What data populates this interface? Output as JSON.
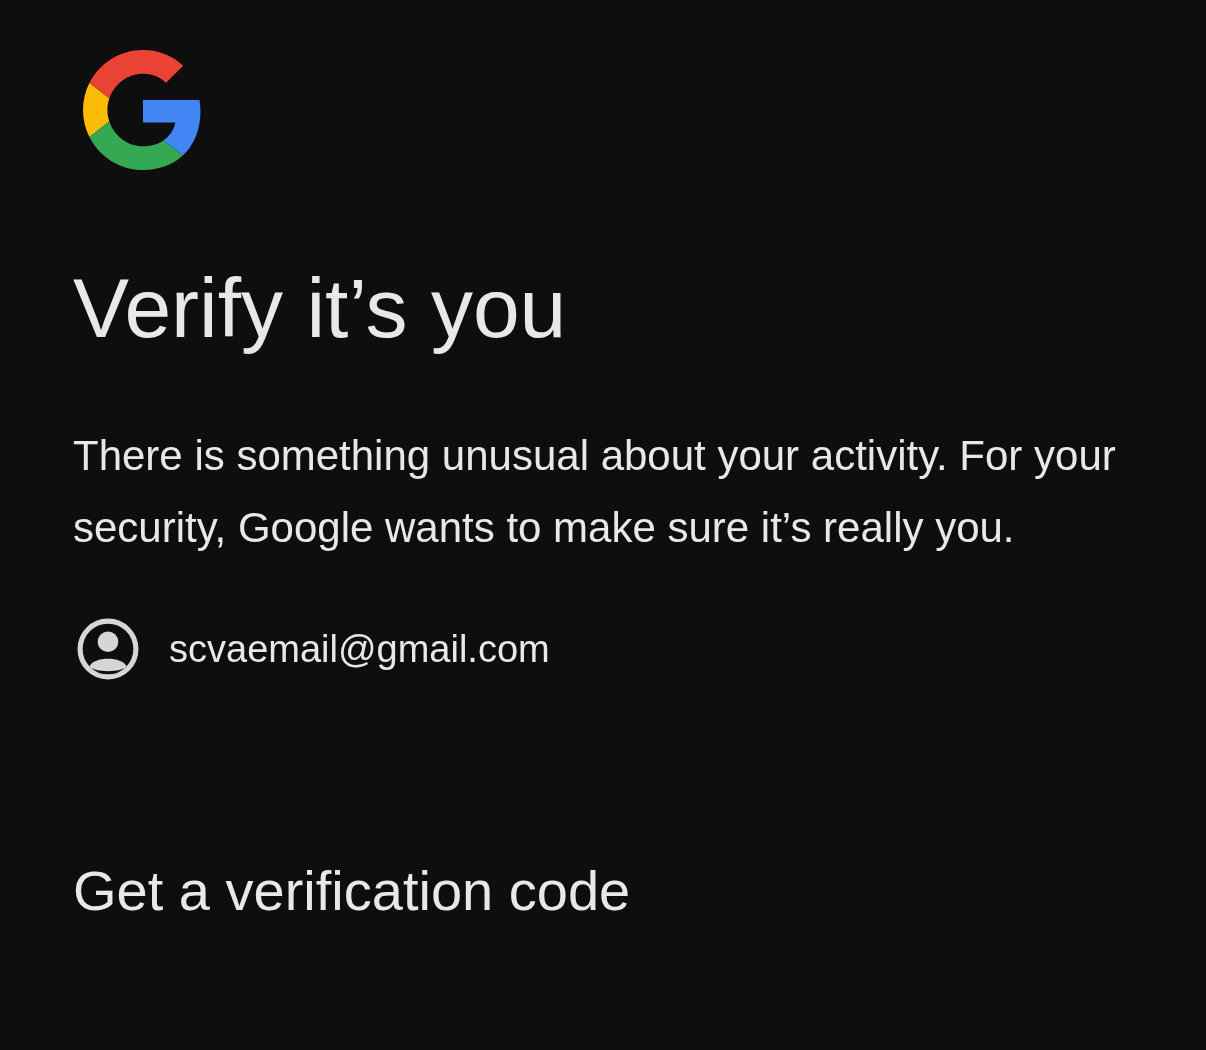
{
  "title": "Verify it’s you",
  "message": "There is something unusual about your activity. For your security, Google wants to make sure it’s really you.",
  "account": {
    "email": "scvaemail@gmail.com"
  },
  "section_heading": "Get a verification code"
}
